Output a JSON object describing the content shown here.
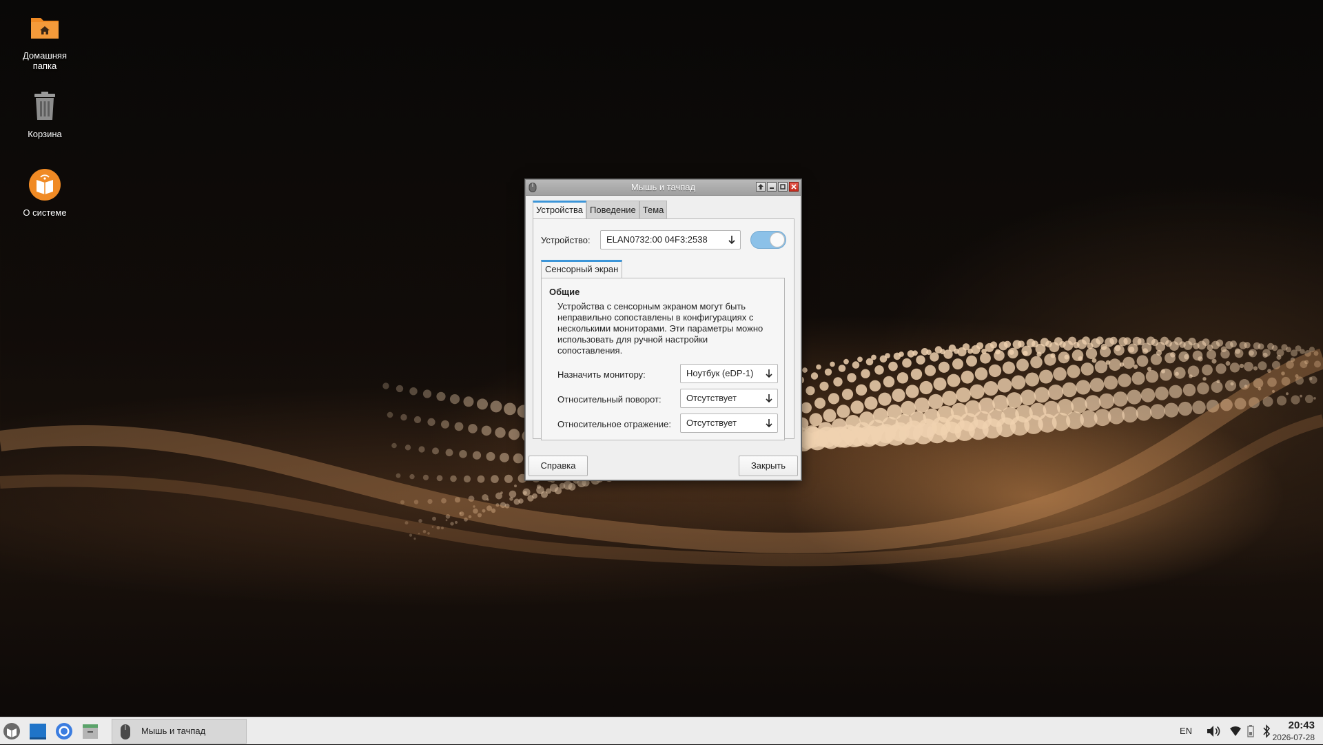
{
  "desktop": {
    "icons": [
      {
        "label_line1": "Домашняя",
        "label_line2": "папка"
      },
      {
        "label": "Корзина"
      },
      {
        "label": "О системе"
      }
    ]
  },
  "dialog": {
    "title": "Мышь и тачпад",
    "tabs": [
      "Устройства",
      "Поведение",
      "Тема"
    ],
    "device_label": "Устройство:",
    "device_value": "ELAN0732:00 04F3:2538",
    "device_enabled": true,
    "subtab": "Сенсорный экран",
    "group_title": "Общие",
    "description": "Устройства с сенсорным экраном могут быть неправильно сопоставлены в конфигурациях с несколькими мониторами. Эти параметры можно использовать для ручной настройки сопоставления.",
    "rows": [
      {
        "label": "Назначить монитору:",
        "value": "Ноутбук (eDP-1)"
      },
      {
        "label": "Относительный поворот:",
        "value": "Отсутствует"
      },
      {
        "label": "Относительное отражение:",
        "value": "Отсутствует"
      }
    ],
    "help_button": "Справка",
    "close_button": "Закрыть"
  },
  "taskbar": {
    "task_label": "Мышь и тачпад",
    "keyboard_layout": "EN",
    "time": "20:43",
    "date": "2026-07-28"
  },
  "colors": {
    "accent": "#3c95d8",
    "toggle_on": "#8cc1e8",
    "close_red": "#d0382b",
    "folder_orange": "#f08a24"
  }
}
